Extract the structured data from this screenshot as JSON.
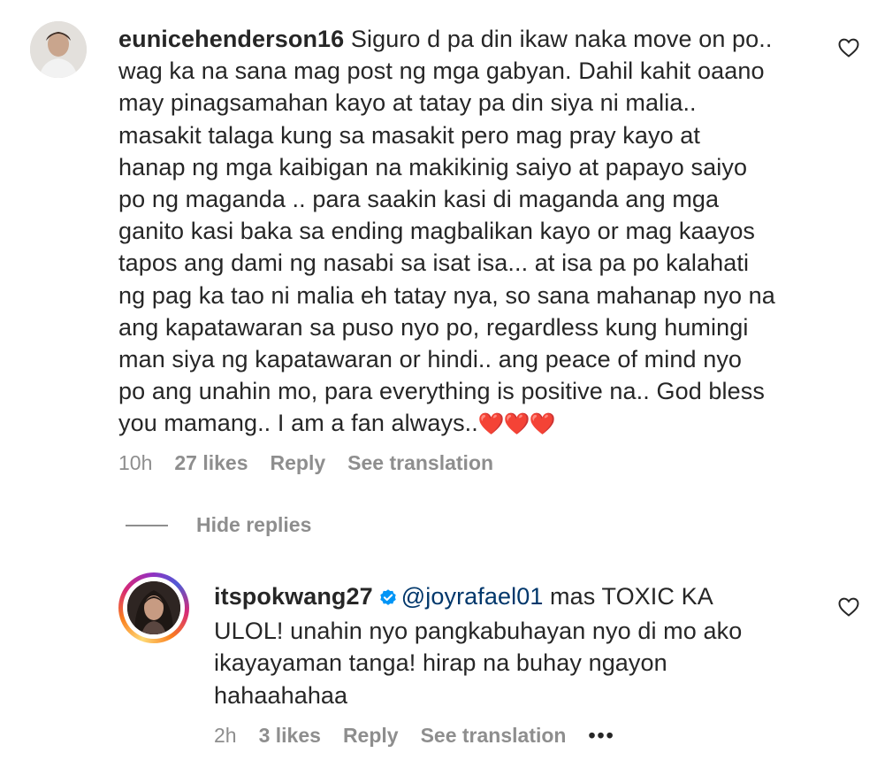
{
  "comments": [
    {
      "username": "eunicehenderson16",
      "text_lines": [
        "Siguro d pa din ikaw naka move on po..",
        "wag ka na sana mag post ng mga gabyan. Dahil kahit oaano",
        "may pinagsamahan kayo at tatay pa din siya ni malia..",
        "masakit talaga kung sa masakit pero mag pray kayo at",
        "hanap ng mga kaibigan na makikinig saiyo at papayo saiyo",
        "po ng maganda .. para saakin kasi di maganda ang mga",
        "ganito kasi baka sa ending magbalikan kayo or mag kaayos",
        "tapos ang dami ng nasabi sa isat isa... at isa pa po kalahati",
        "ng pag ka tao ni malia eh tatay nya, so sana mahanap nyo na",
        "ang kapatawaran sa puso nyo po, regardless kung humingi",
        "man siya ng kapatawaran or hindi.. ang peace of mind nyo",
        "po ang unahin mo, para everything is positive na.. God bless",
        "you mamang.. I am a fan always.."
      ],
      "emoji": "❤️❤️❤️",
      "time": "10h",
      "likes": "27 likes",
      "reply_label": "Reply",
      "translate_label": "See translation"
    }
  ],
  "replies_toggle": {
    "label": "Hide replies"
  },
  "reply": {
    "username": "itspokwang27",
    "verified": true,
    "mention": "@joyrafael01",
    "text_lines": [
      " mas TOXIC KA",
      "ULOL! unahin nyo pangkabuhayan nyo di mo ako",
      "ikayayaman tanga! hirap na buhay ngayon",
      "hahaahahaa"
    ],
    "time": "2h",
    "likes": "3 likes",
    "reply_label": "Reply",
    "translate_label": "See translation",
    "more_label": "•••"
  },
  "icons": {
    "like": "heart-outline-icon",
    "verified": "verified-badge-icon"
  },
  "colors": {
    "text": "#262626",
    "secondary": "#8e8e8e",
    "mention": "#00376b",
    "verified": "#0095f6"
  }
}
